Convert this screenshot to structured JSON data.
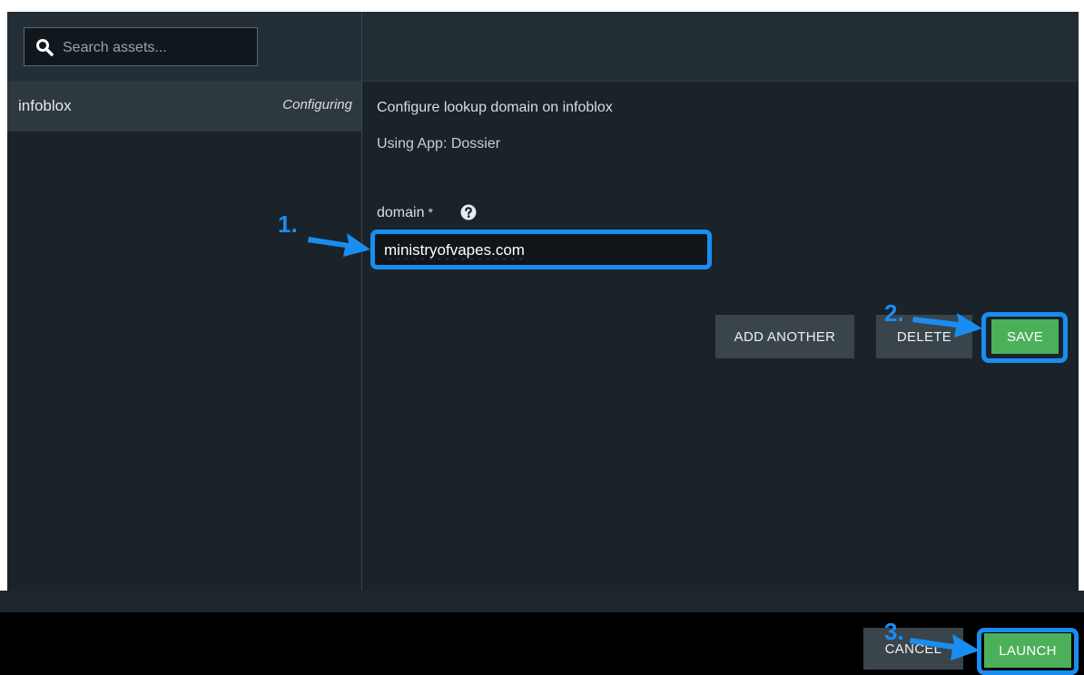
{
  "search": {
    "placeholder": "Search assets..."
  },
  "assets": [
    {
      "name": "infoblox",
      "status": "Configuring"
    }
  ],
  "main": {
    "heading": "Configure lookup domain on infoblox",
    "subheading": "Using App: Dossier",
    "field": {
      "label": "domain",
      "required_mark": "*",
      "value": "ministryofvapes.com"
    },
    "buttons": {
      "add": "ADD ANOTHER",
      "delete": "DELETE",
      "save": "SAVE"
    }
  },
  "footer": {
    "cancel": "CANCEL",
    "launch": "LAUNCH"
  },
  "annotations": {
    "step1": "1.",
    "step2": "2.",
    "step3": "3."
  },
  "colors": {
    "highlight": "#1a8df0",
    "primary_button": "#4cb05b",
    "secondary_button": "#3a444b"
  },
  "icons": {
    "search": "search-icon",
    "help": "question-circle-icon"
  }
}
